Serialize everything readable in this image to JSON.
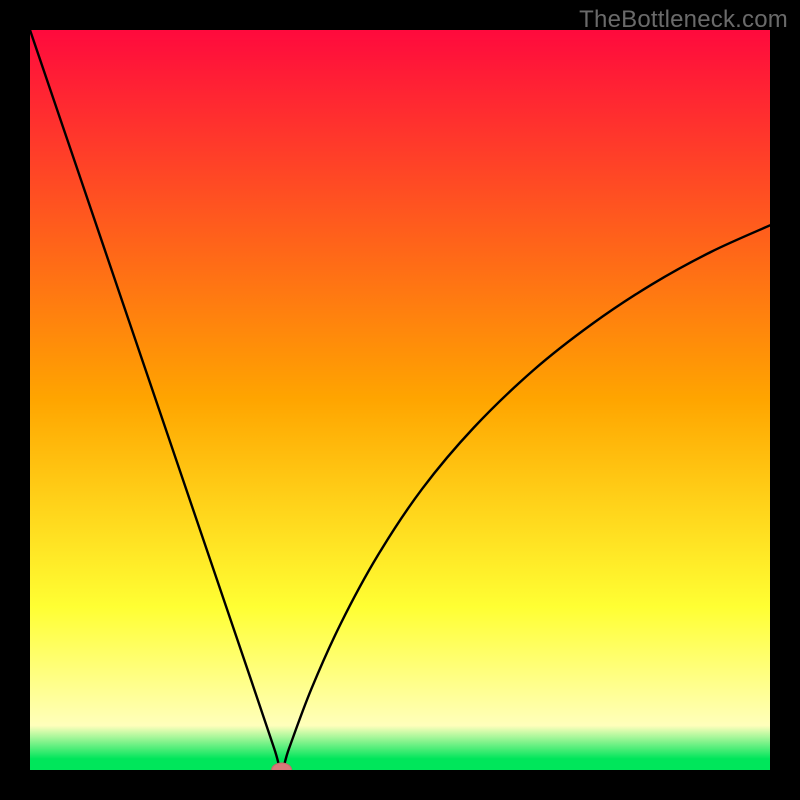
{
  "watermark": "TheBottleneck.com",
  "chart_data": {
    "type": "line",
    "title": "",
    "xlabel": "",
    "ylabel": "",
    "xlim": [
      0,
      1
    ],
    "ylim": [
      0,
      1
    ],
    "background_gradient": {
      "stops": [
        {
          "pos": 0.0,
          "color": "#ff0a3d"
        },
        {
          "pos": 0.5,
          "color": "#ffa500"
        },
        {
          "pos": 0.78,
          "color": "#ffff33"
        },
        {
          "pos": 0.94,
          "color": "#ffffbb"
        },
        {
          "pos": 0.985,
          "color": "#00e65b"
        },
        {
          "pos": 1.0,
          "color": "#00e65b"
        }
      ]
    },
    "curve": {
      "x_min": 0.34,
      "points": [
        {
          "x": 0.0,
          "y": 1.0
        },
        {
          "x": 0.05,
          "y": 0.853
        },
        {
          "x": 0.1,
          "y": 0.706
        },
        {
          "x": 0.15,
          "y": 0.559
        },
        {
          "x": 0.2,
          "y": 0.412
        },
        {
          "x": 0.25,
          "y": 0.265
        },
        {
          "x": 0.3,
          "y": 0.118
        },
        {
          "x": 0.33,
          "y": 0.029
        },
        {
          "x": 0.34,
          "y": 0.0
        },
        {
          "x": 0.35,
          "y": 0.029
        },
        {
          "x": 0.38,
          "y": 0.109
        },
        {
          "x": 0.42,
          "y": 0.198
        },
        {
          "x": 0.47,
          "y": 0.29
        },
        {
          "x": 0.53,
          "y": 0.38
        },
        {
          "x": 0.6,
          "y": 0.463
        },
        {
          "x": 0.68,
          "y": 0.54
        },
        {
          "x": 0.76,
          "y": 0.603
        },
        {
          "x": 0.84,
          "y": 0.656
        },
        {
          "x": 0.92,
          "y": 0.7
        },
        {
          "x": 1.0,
          "y": 0.736
        }
      ]
    },
    "marker": {
      "x": 0.34,
      "y": 0.0,
      "rx": 10,
      "ry": 7,
      "fill": "#d77a7a",
      "stroke": "#c76868"
    }
  }
}
